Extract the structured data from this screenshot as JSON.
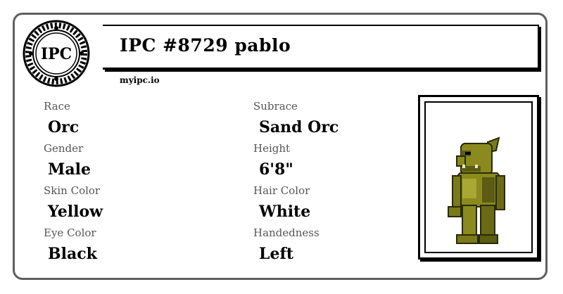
{
  "logo": {
    "text": "IPC",
    "icon": "ipc-seal-logo-icon"
  },
  "header": {
    "title": "IPC #8729 pablo",
    "site": "myipc.io"
  },
  "attributes": [
    {
      "label": "Race",
      "value": "Orc"
    },
    {
      "label": "Subrace",
      "value": "Sand Orc"
    },
    {
      "label": "Gender",
      "value": "Male"
    },
    {
      "label": "Height",
      "value": "6'8\""
    },
    {
      "label": "Skin Color",
      "value": "Yellow"
    },
    {
      "label": "Hair Color",
      "value": "White"
    },
    {
      "label": "Eye Color",
      "value": "Black"
    },
    {
      "label": "Handedness",
      "value": "Left"
    }
  ],
  "portrait": {
    "icon": "orc-character-sprite-icon",
    "colors": {
      "skin": "#8a8a1e",
      "shade": "#5b5b14",
      "light": "#a8a832",
      "outline": "#2a2a08"
    }
  }
}
